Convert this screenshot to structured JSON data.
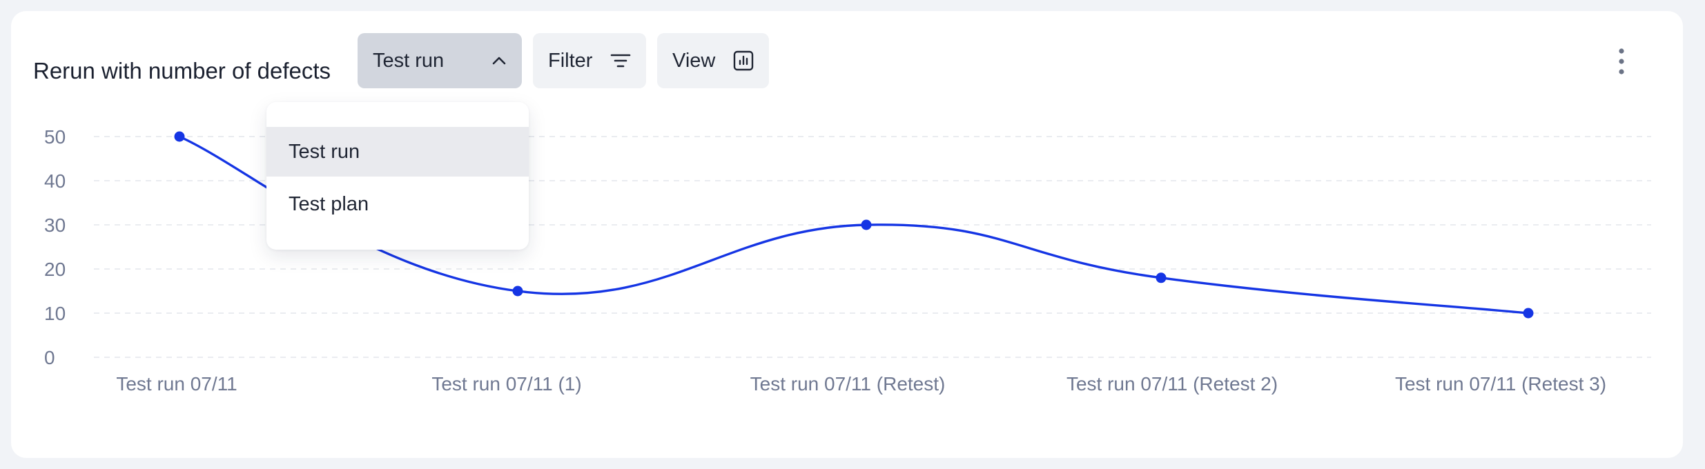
{
  "header": {
    "title": "Rerun with number of defects",
    "select_label": "Test run",
    "filter_label": "Filter",
    "view_label": "View"
  },
  "dropdown": {
    "options": [
      {
        "label": "Test run",
        "selected": true
      },
      {
        "label": "Test plan",
        "selected": false
      }
    ]
  },
  "icons": {
    "select": "chevron-up-icon",
    "filter": "filter-lines-icon",
    "view": "bar-chart-icon",
    "menu": "more-vertical-icon"
  },
  "colors": {
    "line": "#1535e4",
    "select_bg": "#d2d6de",
    "button_bg": "#f0f2f5",
    "grid": "#e3e6ec",
    "tick_text": "#6f7891"
  },
  "chart_data": {
    "type": "line",
    "title": "Rerun with number of defects",
    "xlabel": "",
    "ylabel": "",
    "categories": [
      "Test run 07/11",
      "Test run 07/11 (1)",
      "Test run 07/11 (Retest)",
      "Test run 07/11 (Retest 2)",
      "Test run 07/11 (Retest 3)"
    ],
    "series": [
      {
        "values": [
          50,
          15,
          30,
          18,
          10
        ]
      }
    ],
    "ylim": [
      0,
      50
    ],
    "yticks": [
      0,
      10,
      20,
      30,
      40,
      50
    ],
    "grid": true,
    "smooth": true
  }
}
